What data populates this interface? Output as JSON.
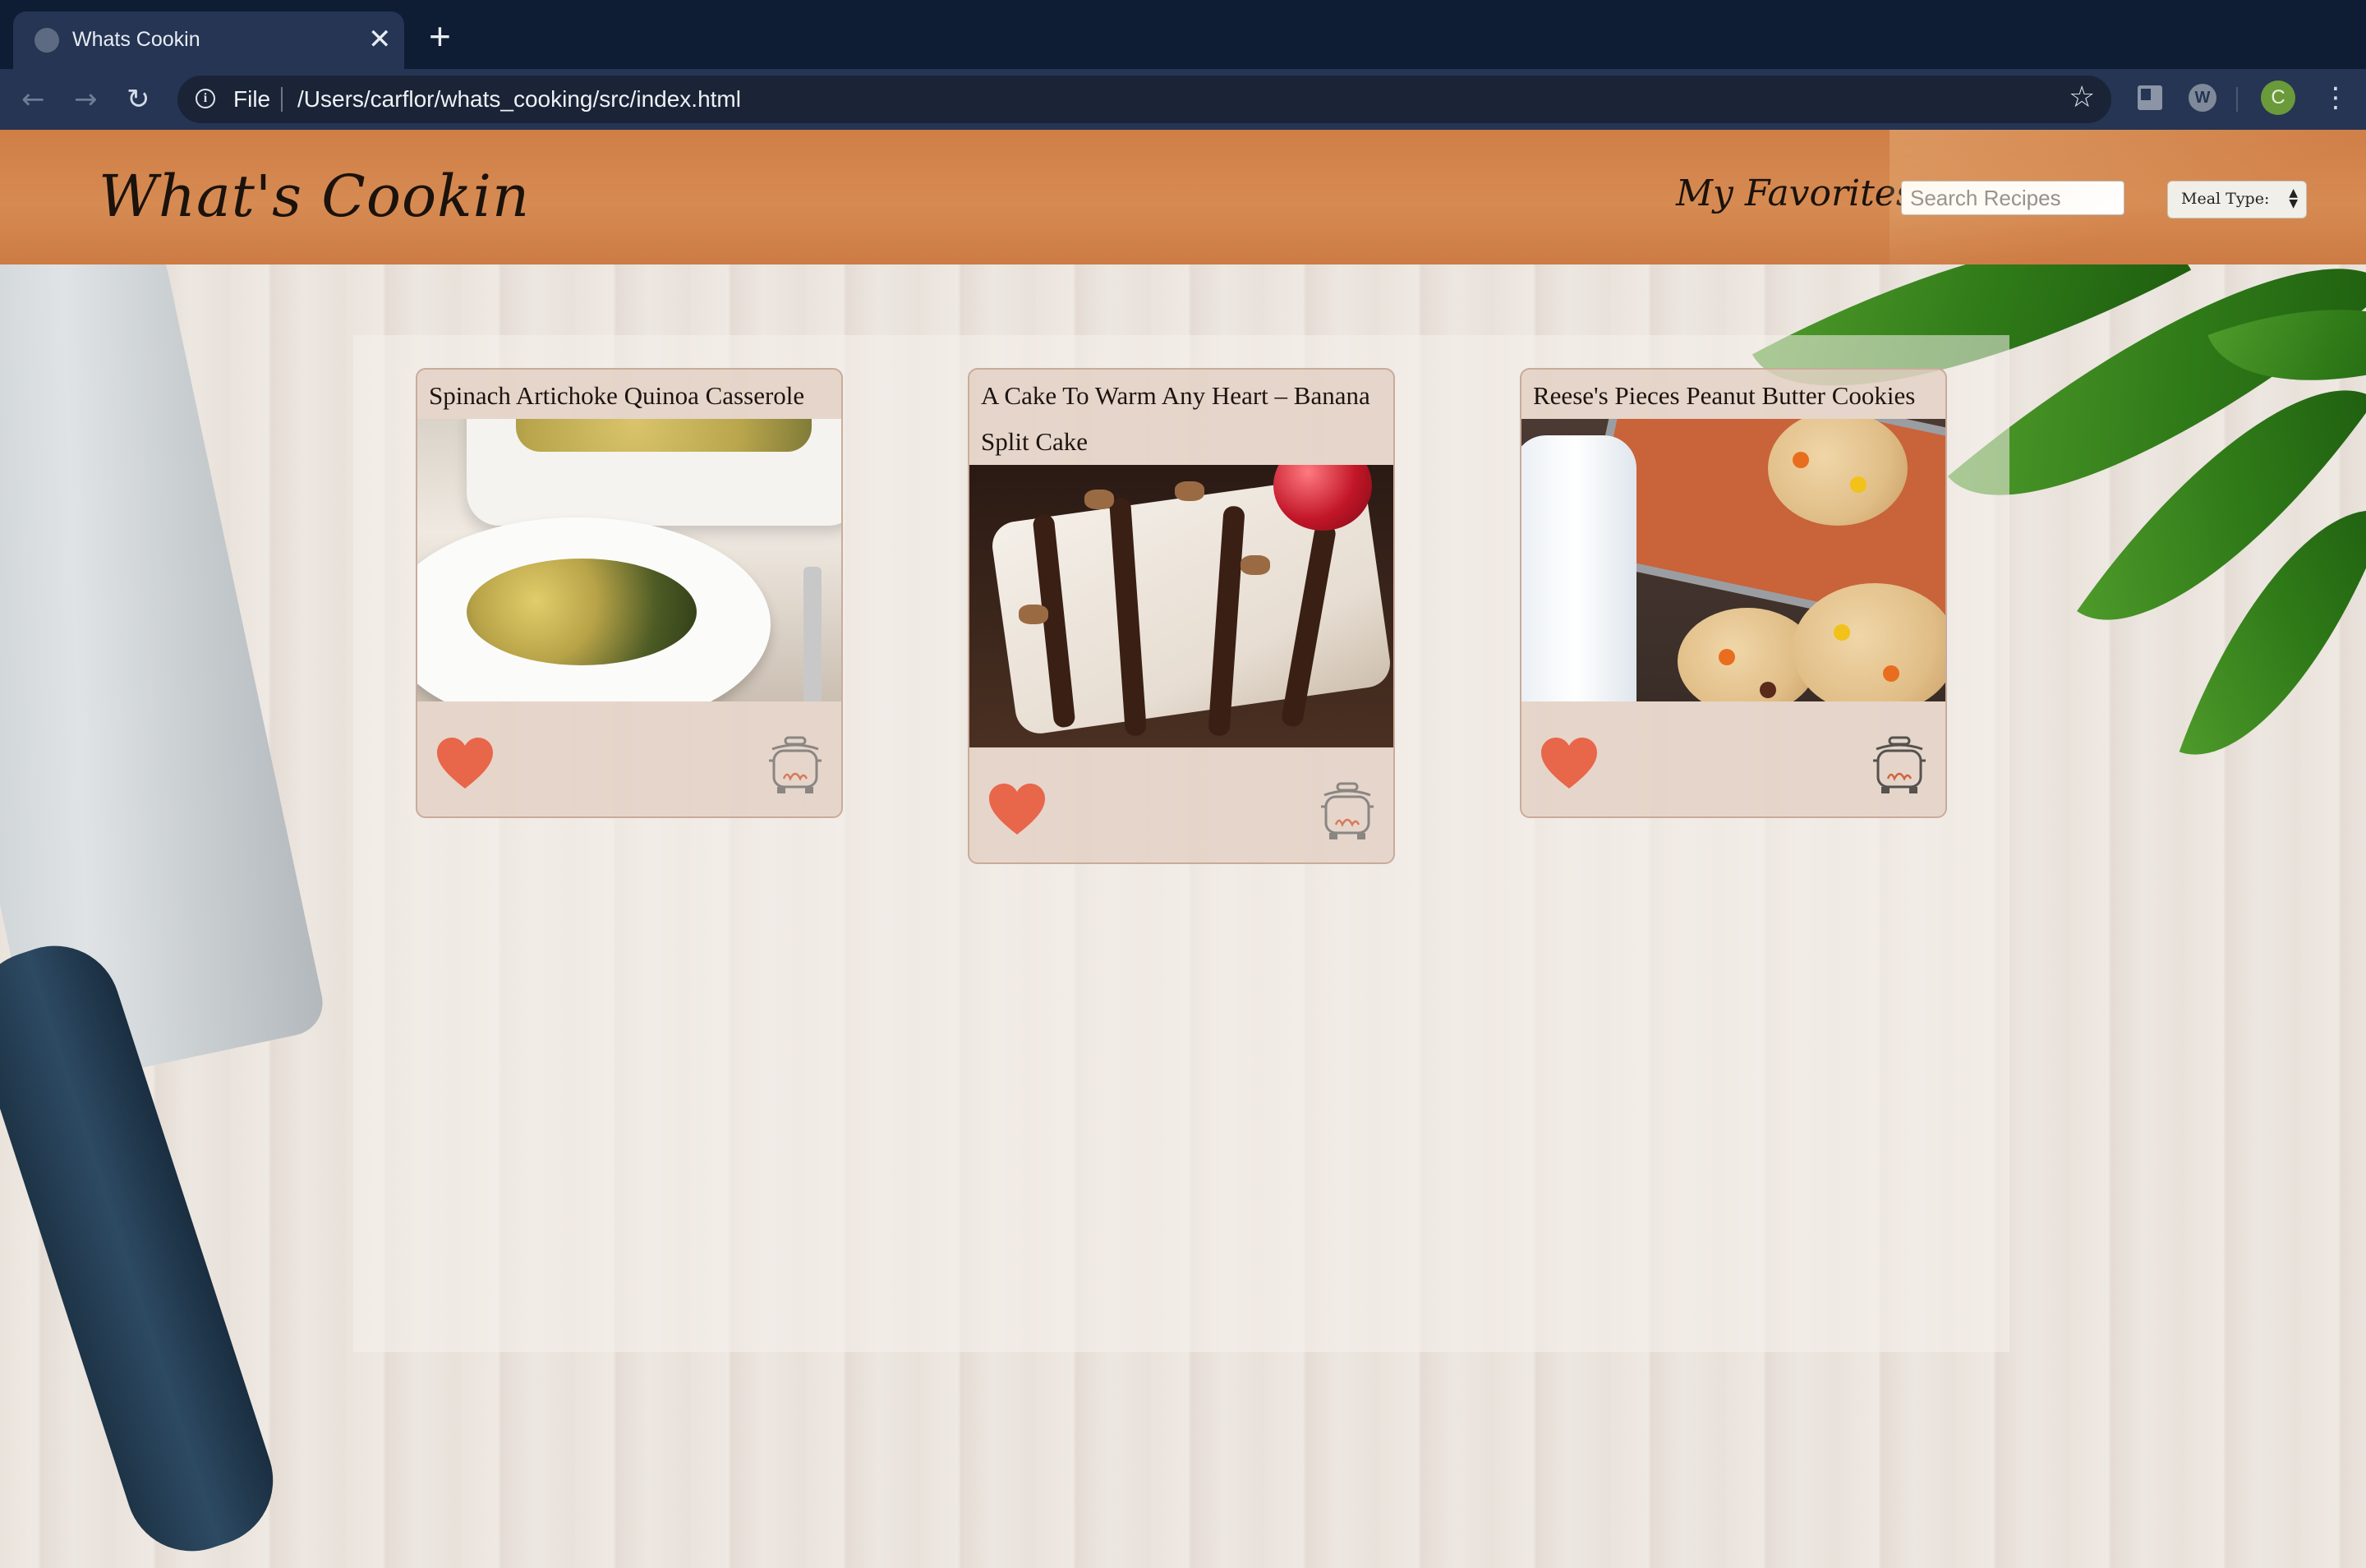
{
  "browser": {
    "tab_title": "Whats Cookin",
    "tab_close": "✕",
    "new_tab": "+",
    "address_scheme": "File",
    "address_url": "/Users/carflor/whats_cooking/src/index.html",
    "profile_initial": "C",
    "extension_label": "W"
  },
  "header": {
    "logo": "What's Cookin",
    "favorites_link": "My Favorites",
    "search_placeholder": "Search Recipes",
    "meal_type_label": "Meal Type:"
  },
  "recipes": [
    {
      "title": "Spinach Artichoke Quinoa Casserole",
      "favorited": true,
      "icons": [
        "heart-icon",
        "pot-icon"
      ]
    },
    {
      "title": "A Cake To Warm Any Heart – Banana Split Cake",
      "favorited": true,
      "icons": [
        "heart-icon",
        "pot-icon"
      ]
    },
    {
      "title": "Reese's Pieces Peanut Butter Cookies",
      "favorited": true,
      "icons": [
        "heart-icon",
        "pot-icon"
      ]
    }
  ],
  "colors": {
    "header_bg": "#d68b52",
    "heart": "#e8664a",
    "card_bg": "#e2cec0",
    "browser_chrome": "#0e1c34"
  }
}
